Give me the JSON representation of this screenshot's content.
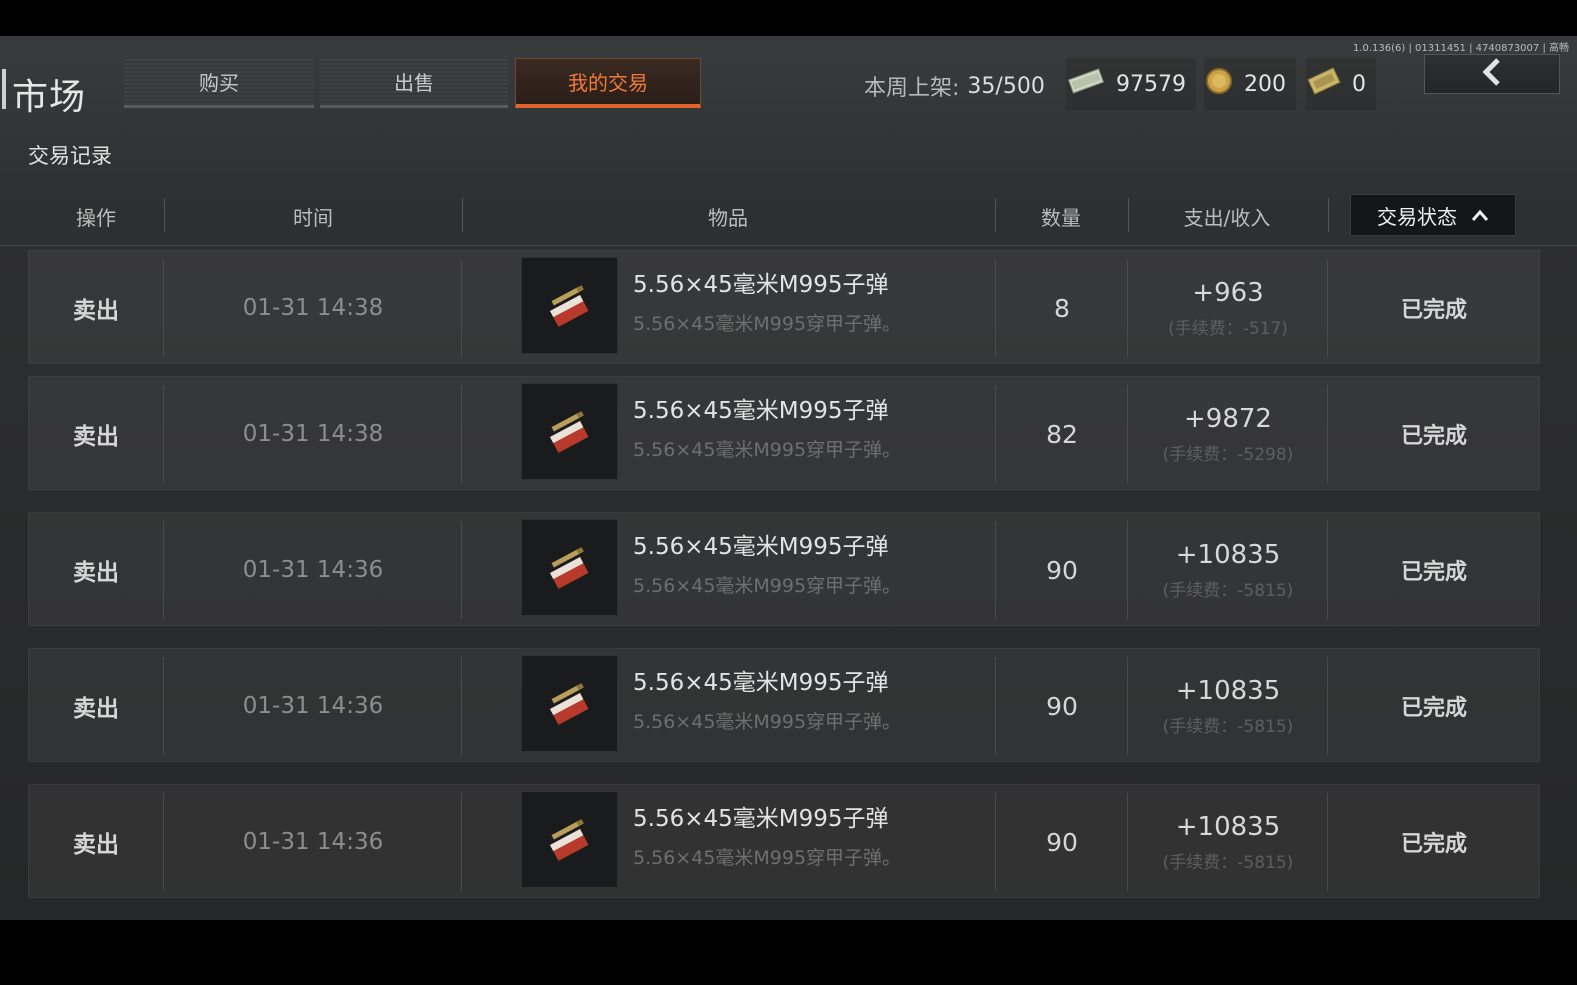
{
  "version_text": "1.0.136(6) | 01311451 | 4740873007 | 高畅",
  "header": {
    "title": "市场",
    "tabs": [
      {
        "label": "购买",
        "active": false
      },
      {
        "label": "出售",
        "active": false
      },
      {
        "label": "我的交易",
        "active": true
      }
    ],
    "weekly_listed_label": "本周上架:",
    "weekly_listed_value": "35/500",
    "currencies": [
      {
        "icon": "cash-icon",
        "value": "97579"
      },
      {
        "icon": "coin-icon",
        "value": "200"
      },
      {
        "icon": "voucher-icon",
        "value": "0"
      }
    ],
    "back_icon": "chevron-left-icon"
  },
  "section_title": "交易记录",
  "table": {
    "columns": [
      "操作",
      "时间",
      "物品",
      "数量",
      "支出/收入",
      "交易状态"
    ],
    "sort_icon": "chevron-up-icon",
    "rows": [
      {
        "op": "卖出",
        "time": "01-31 14:38",
        "item_name": "5.56×45毫米M995子弹",
        "item_desc": "5.56×45毫米M995穿甲子弹。",
        "qty": "8",
        "amount": "+963",
        "fee": "(手续费：-517)",
        "status": "已完成"
      },
      {
        "op": "卖出",
        "time": "01-31 14:38",
        "item_name": "5.56×45毫米M995子弹",
        "item_desc": "5.56×45毫米M995穿甲子弹。",
        "qty": "82",
        "amount": "+9872",
        "fee": "(手续费：-5298)",
        "status": "已完成"
      },
      {
        "op": "卖出",
        "time": "01-31 14:36",
        "item_name": "5.56×45毫米M995子弹",
        "item_desc": "5.56×45毫米M995穿甲子弹。",
        "qty": "90",
        "amount": "+10835",
        "fee": "(手续费：-5815)",
        "status": "已完成"
      },
      {
        "op": "卖出",
        "time": "01-31 14:36",
        "item_name": "5.56×45毫米M995子弹",
        "item_desc": "5.56×45毫米M995穿甲子弹。",
        "qty": "90",
        "amount": "+10835",
        "fee": "(手续费：-5815)",
        "status": "已完成"
      },
      {
        "op": "卖出",
        "time": "01-31 14:36",
        "item_name": "5.56×45毫米M995子弹",
        "item_desc": "5.56×45毫米M995穿甲子弹。",
        "qty": "90",
        "amount": "+10835",
        "fee": "(手续费：-5815)",
        "status": "已完成"
      }
    ]
  },
  "colors": {
    "accent": "#e0622e",
    "background": "#2e2f30"
  }
}
